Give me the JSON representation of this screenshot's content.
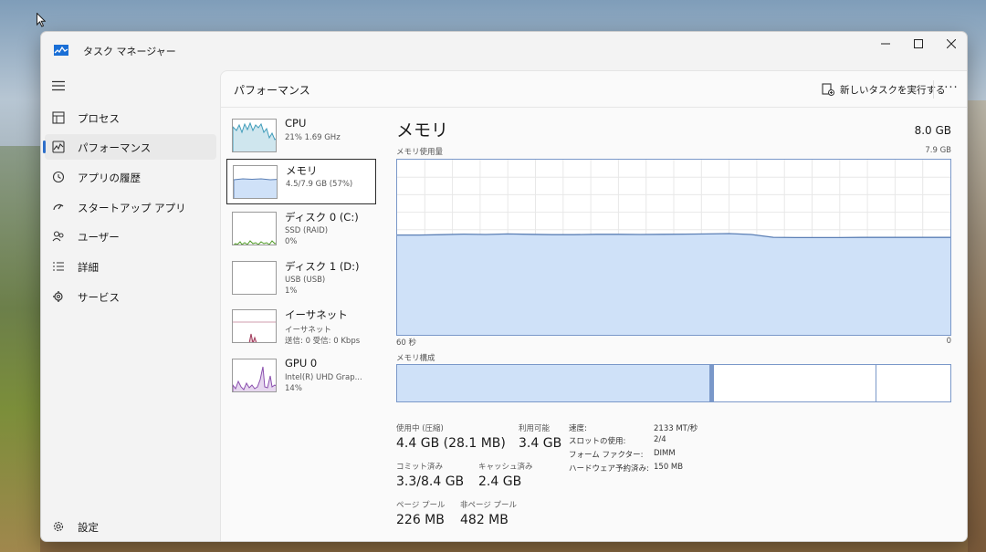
{
  "window": {
    "title": "タスク マネージャー",
    "controls": {
      "minimize": "—",
      "maximize": "☐",
      "close": "✕"
    }
  },
  "sidebar": {
    "items": [
      {
        "label": "プロセス",
        "icon": "processes-icon"
      },
      {
        "label": "パフォーマンス",
        "icon": "performance-icon",
        "active": true
      },
      {
        "label": "アプリの履歴",
        "icon": "history-icon"
      },
      {
        "label": "スタートアップ アプリ",
        "icon": "startup-icon"
      },
      {
        "label": "ユーザー",
        "icon": "users-icon"
      },
      {
        "label": "詳細",
        "icon": "details-icon"
      },
      {
        "label": "サービス",
        "icon": "services-icon"
      }
    ],
    "settings": {
      "label": "設定",
      "icon": "gear-icon"
    }
  },
  "header": {
    "title": "パフォーマンス",
    "run_task": "新しいタスクを実行する",
    "more": "···"
  },
  "devices": [
    {
      "name": "CPU",
      "sub1": "21%  1.69 GHz",
      "sub2": "",
      "sub3": ""
    },
    {
      "name": "メモリ",
      "sub1": "4.5/7.9 GB (57%)",
      "sub2": "",
      "sub3": ""
    },
    {
      "name": "ディスク 0 (C:)",
      "sub1": "SSD (RAID)",
      "sub2": "0%",
      "sub3": ""
    },
    {
      "name": "ディスク 1 (D:)",
      "sub1": "USB (USB)",
      "sub2": "1%",
      "sub3": ""
    },
    {
      "name": "イーサネット",
      "sub1": "イーサネット",
      "sub2": "送信: 0 受信: 0 Kbps",
      "sub3": ""
    },
    {
      "name": "GPU 0",
      "sub1": "Intel(R) UHD Grap...",
      "sub2": "14%",
      "sub3": ""
    }
  ],
  "memory": {
    "title": "メモリ",
    "total": "8.0 GB",
    "usage_label": "メモリ使用量",
    "usage_max": "7.9 GB",
    "axis_left": "60 秒",
    "axis_right": "0",
    "composition_label": "メモリ構成",
    "usage_history": [
      0.57,
      0.57,
      0.572,
      0.575,
      0.573,
      0.576,
      0.574,
      0.572,
      0.572,
      0.574,
      0.574,
      0.573,
      0.574,
      0.575,
      0.576,
      0.578,
      0.573,
      0.557,
      0.555,
      0.555,
      0.555,
      0.556,
      0.556,
      0.556,
      0.556,
      0.556
    ],
    "stats": [
      {
        "label": "使用中 (圧縮)",
        "value": "4.4 GB (28.1 MB)"
      },
      {
        "label": "利用可能",
        "value": "3.4 GB"
      },
      {
        "label": "コミット済み",
        "value": "3.3/8.4 GB"
      },
      {
        "label": "キャッシュ済み",
        "value": "2.4 GB"
      },
      {
        "label": "ページ プール",
        "value": "226 MB"
      },
      {
        "label": "非ページ プール",
        "value": "482 MB"
      }
    ],
    "props": [
      {
        "label": "速度:",
        "value": "2133 MT/秒"
      },
      {
        "label": "スロットの使用:",
        "value": "2/4"
      },
      {
        "label": "フォーム ファクター:",
        "value": "DIMM"
      },
      {
        "label": "ハードウェア予約済み:",
        "value": "150 MB"
      }
    ]
  },
  "colors": {
    "accent": "#2d6ec9",
    "graph_fill": "#cfe1f8",
    "graph_line": "#5b7fb5",
    "graph_border": "#7a98c9"
  }
}
